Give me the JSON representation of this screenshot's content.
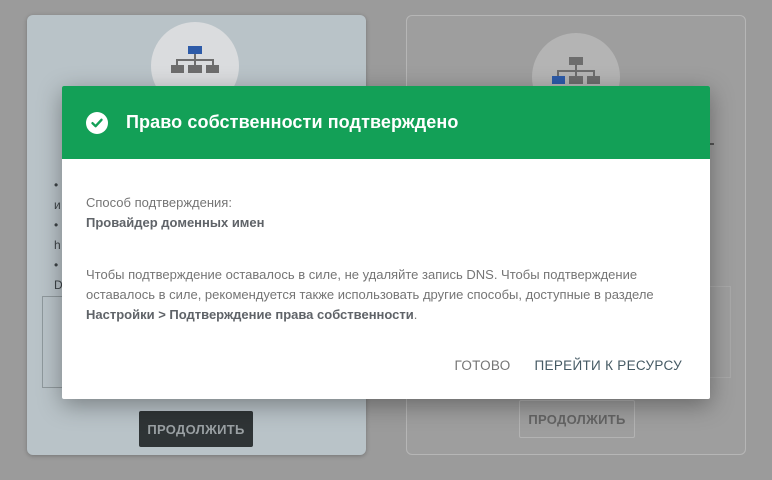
{
  "background": {
    "left_card": {
      "bullet_fragments": [
        "• ",
        "и",
        "• ",
        "h",
        "• ",
        "D"
      ],
      "continue_label": "ПРОДОЛЖИТЬ"
    },
    "right_card": {
      "continue_label": "ПРОДОЛЖИТЬ"
    }
  },
  "modal": {
    "title": "Право собственности подтверждено",
    "method_label": "Способ подтверждения:",
    "method_value": "Провайдер доменных имен",
    "notice_text": "Чтобы подтверждение оставалось в силе, не удаляйте запись DNS. Чтобы подтверждение оставалось в силе, рекомендуется также использовать другие способы, доступные в разделе ",
    "notice_link": "Настройки > Подтверждение права собственности",
    "notice_end": ".",
    "done_label": "ГОТОВО",
    "go_label": "ПЕРЕЙТИ К РЕСУРСУ",
    "header_color": "#13a057",
    "check_icon": "check-circle-icon"
  }
}
